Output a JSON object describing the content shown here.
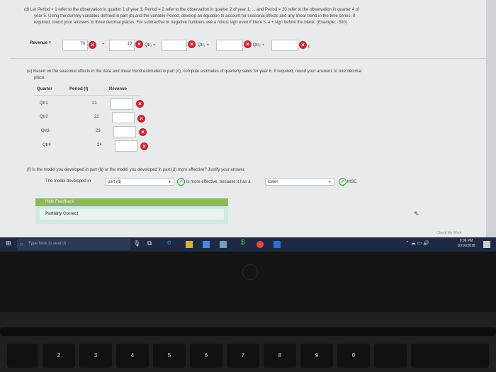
{
  "part_d": {
    "line1": "(d) Let Period = 1 refer to the observation in quarter 1 of year 1; Period = 2 refer to the observation in quarter 2 of year 1; ... and Period = 20 refer to the observation in quarter 4 of",
    "line2": "year 5. Using the dummy variables defined in part (b) and the variable Period, develop an equation to account for seasonal effects and any linear trend in the time series. If",
    "line3": "required, round your answers to three decimal places. For subtractive or negative numbers use a minus sign even if there is a + sign before the blank. (Example: -300)",
    "revenue_label": "Revenue =",
    "intercept_value": "70",
    "plus": "+",
    "qtr1_coef": "10",
    "qtr1_label": "Qtr₁ +",
    "qtr2_label": "Qtr₂ +",
    "qtr3_label": "Qtr₃ +",
    "t_label": "t"
  },
  "part_e": {
    "line1": "(e) Based on the seasonal effects in the data and linear trend estimated in part (c), compute estimates of quarterly sales for year 6. If required, round your answers to one decimal",
    "line2": "place.",
    "headers": {
      "quarter": "Quarter",
      "period": "Period (t)",
      "revenue": "Revenue"
    },
    "rows": [
      {
        "quarter": "Qtr1",
        "period": "21",
        "revenue": ""
      },
      {
        "quarter": "Qtr2",
        "period": "22",
        "revenue": ""
      },
      {
        "quarter": "Qtr3",
        "period": "23",
        "revenue": ""
      },
      {
        "quarter": "Qtr4",
        "period": "24",
        "revenue": ""
      }
    ]
  },
  "part_f": {
    "question": "(f) Is the model you developed in part (b) or the model you developed in part (d) more effective? Justify your answer.",
    "prefix": "The model developed in",
    "select1": "part (d)",
    "middle": "is more effective, because it has a",
    "select2": "lower",
    "suffix": "MSE."
  },
  "feedback": {
    "hide_label": "Hide Feedback",
    "status": "Partially Correct"
  },
  "bottom_right": "Check My Work",
  "taskbar": {
    "search_placeholder": "Type here to search",
    "time": "9:06 PM",
    "date": "10/16/2018"
  },
  "keyboard": {
    "number_keys": [
      "2",
      "3",
      "4",
      "5",
      "6",
      "7",
      "8",
      "9",
      "0"
    ]
  },
  "colors": {
    "wrong": "#c8263a",
    "correct": "#3a9a3a",
    "feedback_bg": "#cfe8e4",
    "feedback_btn": "#8cb75a"
  }
}
